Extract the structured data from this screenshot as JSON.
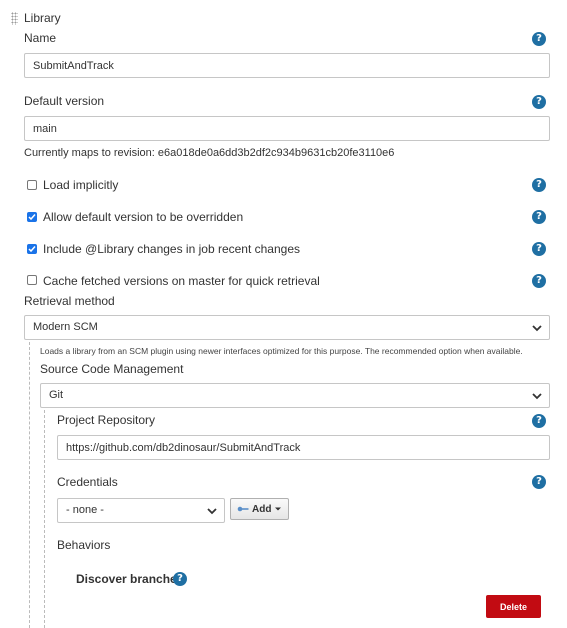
{
  "library": {
    "section_title": "Library",
    "name_label": "Name",
    "name_value": "SubmitAndTrack",
    "default_version_label": "Default version",
    "default_version_value": "main",
    "revision_text": "Currently maps to revision: e6a018de0a6dd3b2df2c934b9631cb20fe3110e6",
    "options": [
      {
        "label": "Load implicitly",
        "checked": false
      },
      {
        "label": "Allow default version to be overridden",
        "checked": true
      },
      {
        "label": "Include @Library changes in job recent changes",
        "checked": true
      },
      {
        "label": "Cache fetched versions on master for quick retrieval",
        "checked": false
      }
    ],
    "retrieval_label": "Retrieval method",
    "retrieval_value": "Modern SCM",
    "retrieval_desc": "Loads a library from an SCM plugin using newer interfaces optimized for this purpose. The recommended option when available.",
    "scm_label": "Source Code Management",
    "scm_value": "Git",
    "repo_label": "Project Repository",
    "repo_value": "https://github.com/db2dinosaur/SubmitAndTrack",
    "credentials_label": "Credentials",
    "credentials_value": "- none -",
    "add_label": "Add",
    "behaviors_label": "Behaviors",
    "discover_label": "Discover branches",
    "delete_label": "Delete",
    "help_glyph": "?"
  },
  "colors": {
    "help": "#1f6fa3",
    "checkbox_checked": "#1a73e8",
    "delete": "#c20b12"
  }
}
